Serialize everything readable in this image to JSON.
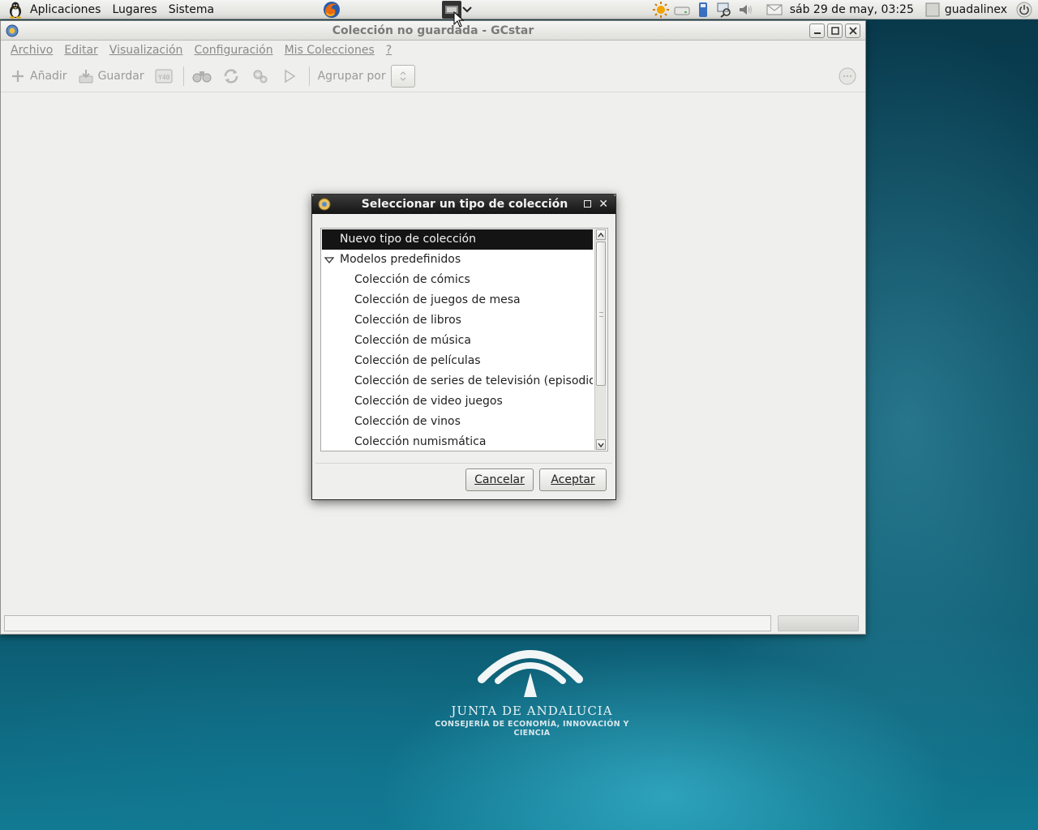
{
  "panel": {
    "menus": [
      "Aplicaciones",
      "Lugares",
      "Sistema"
    ],
    "clock": "sáb 29 de may, 03:25",
    "user": "guadalinex"
  },
  "window": {
    "title": "Colección no guardada - GCstar",
    "menu": [
      "Archivo",
      "Editar",
      "Visualización",
      "Configuración",
      "Mis Colecciones",
      "?"
    ],
    "toolbar": {
      "add_label": "Añadir",
      "save_label": "Guardar",
      "group_label": "Agrupar por"
    }
  },
  "dialog": {
    "title": "Seleccionar un tipo de colección",
    "rows": [
      {
        "label": "Nuevo tipo de colección",
        "level": 0,
        "selected": true
      },
      {
        "label": "Modelos predefinidos",
        "level": 0,
        "expanded": true
      },
      {
        "label": "Colección de cómics",
        "level": 1
      },
      {
        "label": "Colección de juegos de mesa",
        "level": 1
      },
      {
        "label": "Colección de libros",
        "level": 1
      },
      {
        "label": "Colección de música",
        "level": 1
      },
      {
        "label": "Colección de películas",
        "level": 1
      },
      {
        "label": "Colección de series de televisión (episodios)",
        "level": 1
      },
      {
        "label": "Colección de video juegos",
        "level": 1
      },
      {
        "label": "Colección de vinos",
        "level": 1
      },
      {
        "label": "Colección numismática",
        "level": 1
      }
    ],
    "cancel_label": "Cancelar",
    "ok_label": "Aceptar"
  },
  "wallpaper": {
    "org": "JUNTA DE ANDALUCIA",
    "dept": "CONSEJERÍA DE ECONOMÍA, INNOVACIÓN Y CIENCIA"
  },
  "colors": {
    "selection": "#141414",
    "dialog_title_bg": "#1f1f1f",
    "desktop": "#0b4a5e"
  },
  "icons": [
    "distro-logo-icon",
    "firefox-icon",
    "screenshot-app-icon",
    "weather-icon",
    "drive-icon",
    "usb-icon",
    "network-icon",
    "volume-icon",
    "mail-icon",
    "power-icon",
    "gcstar-icon",
    "add-icon",
    "save-icon",
    "export-icon",
    "search-icon",
    "refresh-icon",
    "settings-icon",
    "play-icon"
  ]
}
